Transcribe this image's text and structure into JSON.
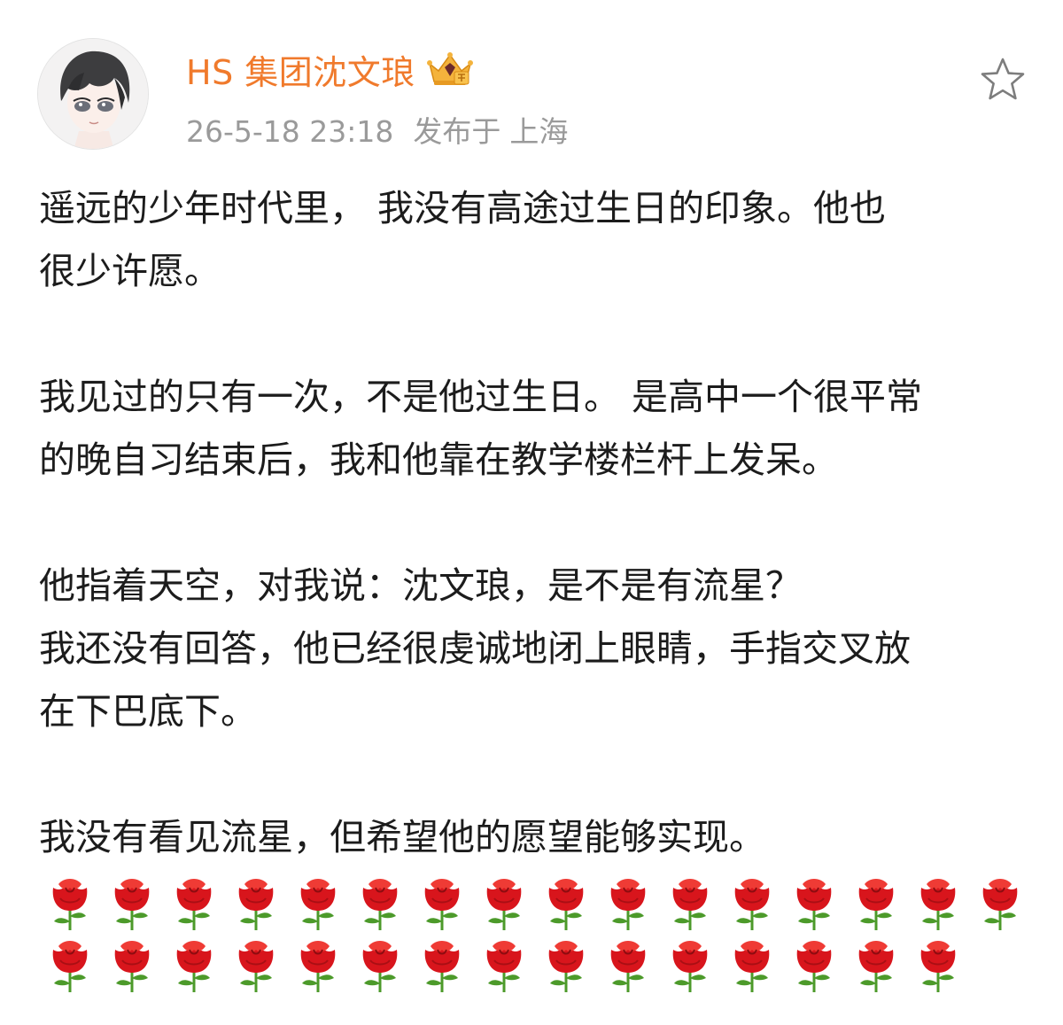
{
  "user": {
    "name": "HS 集团沈文琅",
    "avatar_icon": "avatar-image",
    "badge_icon": "vip-crown-icon"
  },
  "meta": {
    "time": "26-5-18 23:18",
    "location_label": "发布于",
    "location": "上海"
  },
  "actions": {
    "favorite_icon": "star-outline-icon"
  },
  "post": {
    "paragraphs": [
      [
        "遥远的少年时代里， 我没有高途过生日的印象。他也",
        "很少许愿。"
      ],
      [
        "我见过的只有一次，不是他过生日。 是高中一个很平常",
        "的晚自习结束后，我和他靠在教学楼栏杆上发呆。"
      ],
      [
        "他指着天空，对我说：沈文琅，是不是有流星？",
        "我还没有回答，他已经很虔诚地闭上眼睛，手指交叉放",
        "在下巴底下。"
      ],
      [
        "我没有看见流星，但希望他的愿望能够实现。"
      ]
    ],
    "rose_rows": [
      16,
      15
    ],
    "rose_icon": "rose-emoji-icon"
  },
  "colors": {
    "username": "#f07a2c",
    "meta": "#9a9a9a",
    "text": "#1c1c1c",
    "rose_red": "#d8151c",
    "rose_green": "#4c9a2a"
  }
}
